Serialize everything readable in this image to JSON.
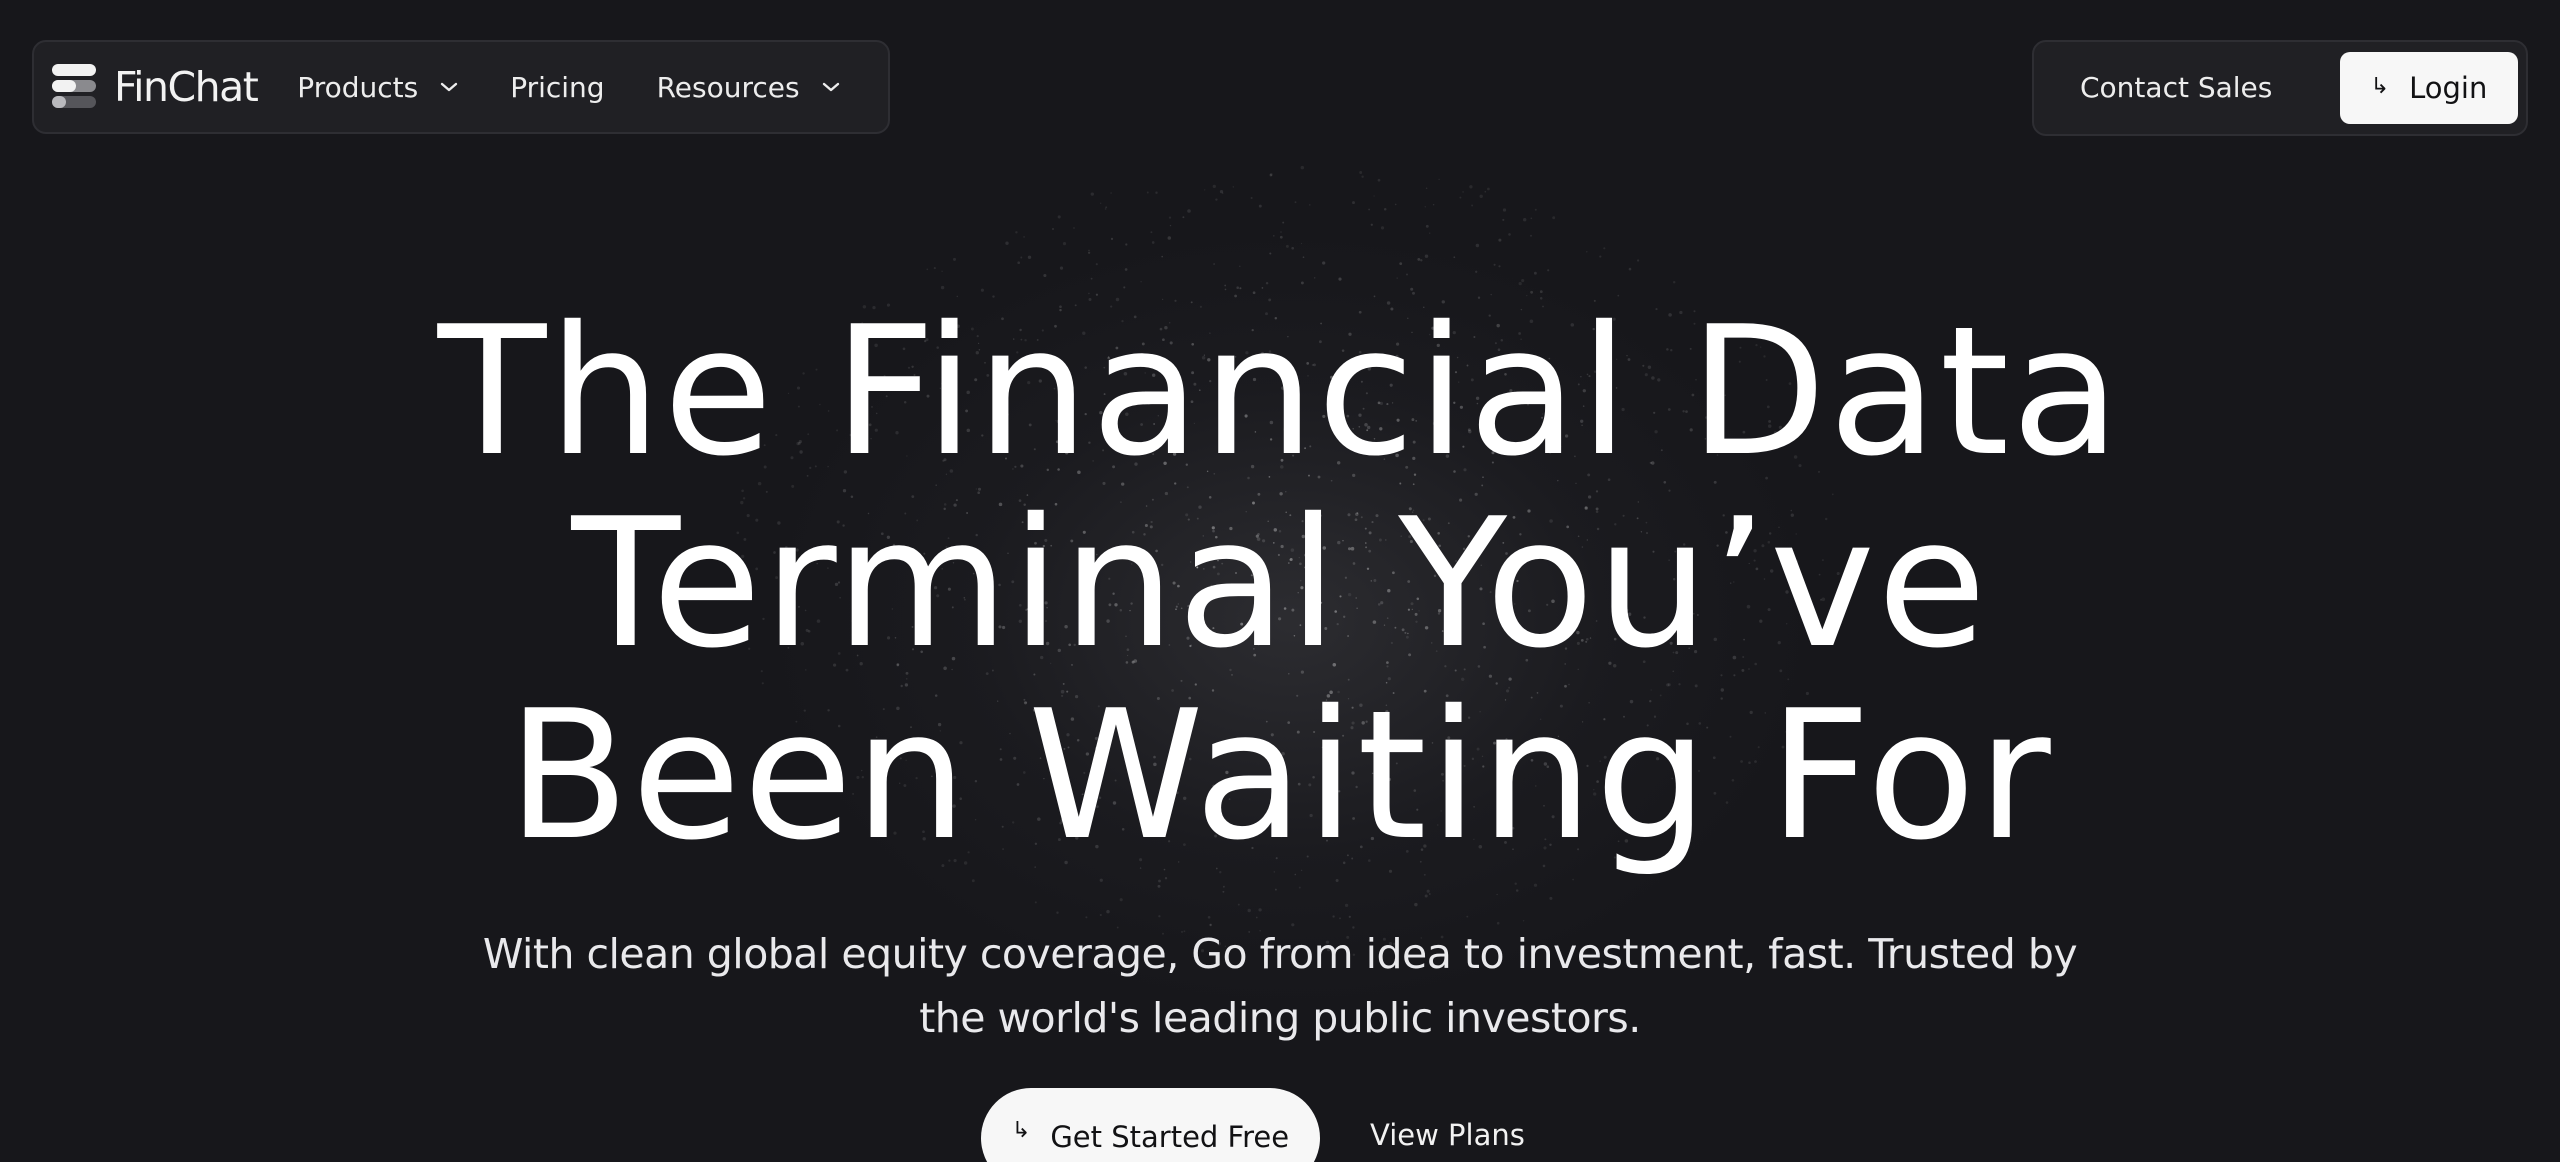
{
  "brand": {
    "name": "FinChat",
    "logo_icon": "finchat-logo-icon"
  },
  "nav": {
    "items": [
      {
        "label": "Products",
        "has_dropdown": true
      },
      {
        "label": "Pricing",
        "has_dropdown": false
      },
      {
        "label": "Resources",
        "has_dropdown": true
      }
    ],
    "contact_sales": "Contact Sales",
    "login": {
      "label": "Login",
      "icon": "return-arrow-icon"
    }
  },
  "hero": {
    "title_lines": [
      "The Financial Data",
      "Terminal You’ve",
      "Been Waiting For"
    ],
    "subtitle_lines": [
      "With clean global equity coverage, Go from idea to investment, fast. Trusted by",
      "the world's leading public investors."
    ],
    "cta_primary": {
      "label": "Get Started Free",
      "icon": "return-arrow-icon"
    },
    "cta_secondary": {
      "label": "View Plans"
    }
  },
  "colors": {
    "background": "#17171b",
    "panel": "#202024",
    "panel_border": "#2e2e33",
    "button_light": "#f7f7f7",
    "text_primary": "#ffffff",
    "text_dark": "#121214"
  }
}
